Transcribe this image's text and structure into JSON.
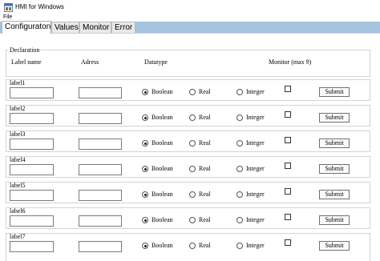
{
  "window": {
    "title": "HMI for Windows"
  },
  "menu": {
    "file": "File"
  },
  "tabs": [
    {
      "label": "Configuraton",
      "active": true
    },
    {
      "label": "Values",
      "active": false
    },
    {
      "label": "Monitor",
      "active": false
    },
    {
      "label": "Error",
      "active": false
    }
  ],
  "declaration": {
    "legend": "Declaration",
    "headers": {
      "label_name": "Label name",
      "address": "Adress",
      "datatype": "Datatype",
      "monitor": "Monitor (max 9)"
    }
  },
  "rows": [
    {
      "label": "label1",
      "name_value": "",
      "address_value": "",
      "datatype_selected": "Boolean",
      "monitor_checked": false
    },
    {
      "label": "label2",
      "name_value": "",
      "address_value": "",
      "datatype_selected": "Boolean",
      "monitor_checked": false
    },
    {
      "label": "label3",
      "name_value": "",
      "address_value": "",
      "datatype_selected": "Boolean",
      "monitor_checked": false
    },
    {
      "label": "label4",
      "name_value": "",
      "address_value": "",
      "datatype_selected": "Boolean",
      "monitor_checked": false
    },
    {
      "label": "label5",
      "name_value": "",
      "address_value": "",
      "datatype_selected": "Boolean",
      "monitor_checked": false
    },
    {
      "label": "label6",
      "name_value": "",
      "address_value": "",
      "datatype_selected": "Boolean",
      "monitor_checked": false
    },
    {
      "label": "label7",
      "name_value": "",
      "address_value": "",
      "datatype_selected": "Boolean",
      "monitor_checked": false
    }
  ],
  "datatype_options": [
    "Boolean",
    "Real",
    "Integer"
  ],
  "submit_label": "Submit",
  "colors": {
    "tab_strip": "#a3c3df",
    "border": "#d4d4d4"
  },
  "icons": {
    "app": "app-window-icon"
  }
}
